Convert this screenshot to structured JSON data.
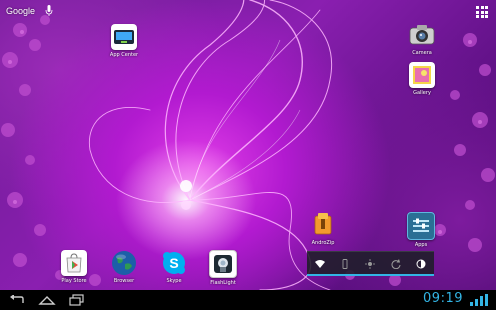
{
  "top_bar": {
    "search_label": "Google",
    "icons": [
      "microphone-icon",
      "all-apps-icon"
    ]
  },
  "apps": {
    "app_center": "App Center",
    "camera": "Camera",
    "gallery": "Gallery",
    "androzip": "AndroZip",
    "apps_folder": "Apps",
    "play_store": "Play Store",
    "browser": "Browser",
    "skype": "Skype",
    "flashlight": "FlashLight"
  },
  "quick_settings": {
    "items": [
      "wifi-icon",
      "vibrate-icon",
      "brightness-icon",
      "sync-icon",
      "auto-rotate-icon"
    ],
    "accent": "#33b5e5"
  },
  "status_bar": {
    "time": "09:19",
    "nav_buttons": [
      "back-icon",
      "home-icon",
      "recent-apps-icon"
    ]
  }
}
